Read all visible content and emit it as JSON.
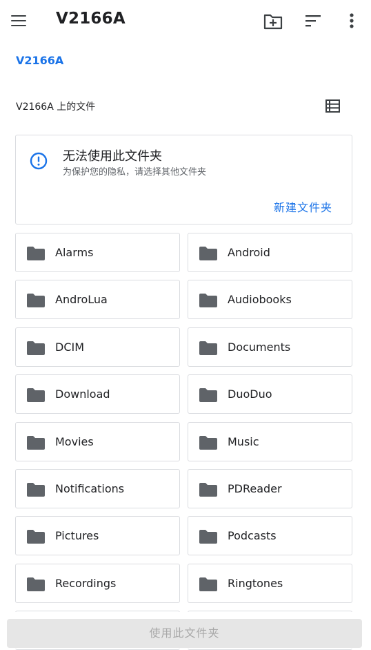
{
  "app_bar": {
    "title": "V2166A",
    "icons": [
      "menu-icon",
      "create-folder-icon",
      "sort-icon",
      "more-vert-icon"
    ]
  },
  "breadcrumb": "V2166A",
  "section_title": "V2166A 上的文件",
  "notice": {
    "title": "无法使用此文件夹",
    "subtitle": "为保护您的隐私，请选择其他文件夹",
    "action": "新建文件夹"
  },
  "folders": [
    "Alarms",
    "Android",
    "AndroLua",
    "Audiobooks",
    "DCIM",
    "Documents",
    "Download",
    "DuoDuo",
    "Movies",
    "Music",
    "Notifications",
    "PDReader",
    "Pictures",
    "Podcasts",
    "Recordings",
    "Ringtones"
  ],
  "bottom_button": "使用此文件夹",
  "colors": {
    "accent": "#1a73e8",
    "folder_icon": "#5f6368",
    "border": "#dadce0",
    "disabled_button_bg": "#e6e6e6",
    "disabled_button_text": "#a8a8a8"
  }
}
